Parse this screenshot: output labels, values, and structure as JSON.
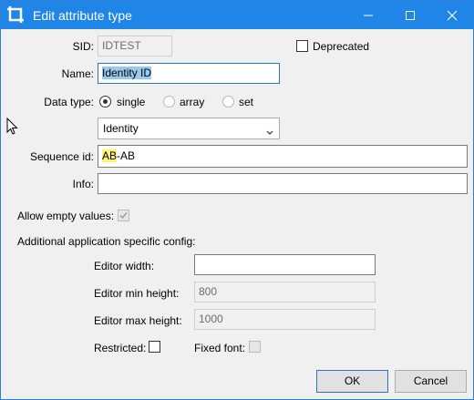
{
  "window": {
    "title": "Edit attribute type"
  },
  "form": {
    "sid_label": "SID:",
    "sid_value": "IDTEST",
    "deprecated_label": "Deprecated",
    "deprecated_checked": false,
    "name_label": "Name:",
    "name_value": "Identity ID",
    "datatype_label": "Data type:",
    "datatype_options": [
      "single",
      "array",
      "set"
    ],
    "datatype_selected": "single",
    "type_select_value": "Identity",
    "sequence_label": "Sequence id:",
    "sequence_highlight": "AB",
    "sequence_rest": "-AB",
    "info_label": "Info:",
    "info_value": "",
    "allow_empty_label": "Allow empty values:",
    "allow_empty_checked": true
  },
  "config": {
    "heading": "Additional application specific config:",
    "editor_width_label": "Editor width:",
    "editor_width_value": "",
    "editor_min_height_label": "Editor min height:",
    "editor_min_height_value": "800",
    "editor_max_height_label": "Editor max height:",
    "editor_max_height_value": "1000",
    "restricted_label": "Restricted:",
    "restricted_checked": false,
    "fixed_font_label": "Fixed font:",
    "fixed_font_checked": false
  },
  "buttons": {
    "ok": "OK",
    "cancel": "Cancel"
  },
  "colors": {
    "titlebar": "#1f85e6",
    "selection": "#99c9ef",
    "highlight": "#fff27a",
    "focus_border": "#2a73c6"
  },
  "icons": {
    "app": "crop-frame-icon",
    "minimize": "minimize-icon",
    "maximize": "maximize-icon",
    "close": "close-icon",
    "dropdown": "chevron-down-icon",
    "check": "checkmark-icon",
    "cursor": "mouse-pointer-icon"
  }
}
